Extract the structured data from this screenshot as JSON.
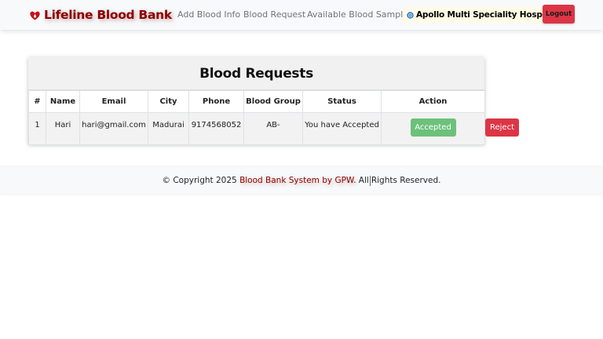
{
  "navbar": {
    "brand": "Lifeline Blood Bank",
    "brand_icon": "blood-drop-heart-icon",
    "links": [
      "Add Blood Info",
      "Blood Request",
      "Available Blood Samples"
    ],
    "hospital_name": "Apollo Multi Speciality Hospital",
    "hospital_icon": "hospital-logo-icon",
    "logout_label": "Logout"
  },
  "requests": {
    "title": "Blood Requests",
    "columns": [
      "#",
      "Name",
      "Email",
      "City",
      "Phone",
      "Blood Group",
      "Status",
      "Action"
    ],
    "rows": [
      {
        "index": "1",
        "name": "Hari",
        "email": "hari@gmail.com",
        "city": "Madurai",
        "phone": "9174568052",
        "blood_group": "AB-",
        "status": "You have Accepted",
        "accept_label": "Accepted",
        "reject_label": "Reject"
      }
    ]
  },
  "footer": {
    "prefix": "© Copyright 2025",
    "brand": "Blood Bank System by GPW.",
    "suffix_a": "All",
    "suffix_b": "Rights Reserved."
  },
  "colors": {
    "brand": "#8b0000",
    "danger": "#dc3545",
    "success": "#6cc17b",
    "navbar_bg": "#f8f9fa"
  }
}
